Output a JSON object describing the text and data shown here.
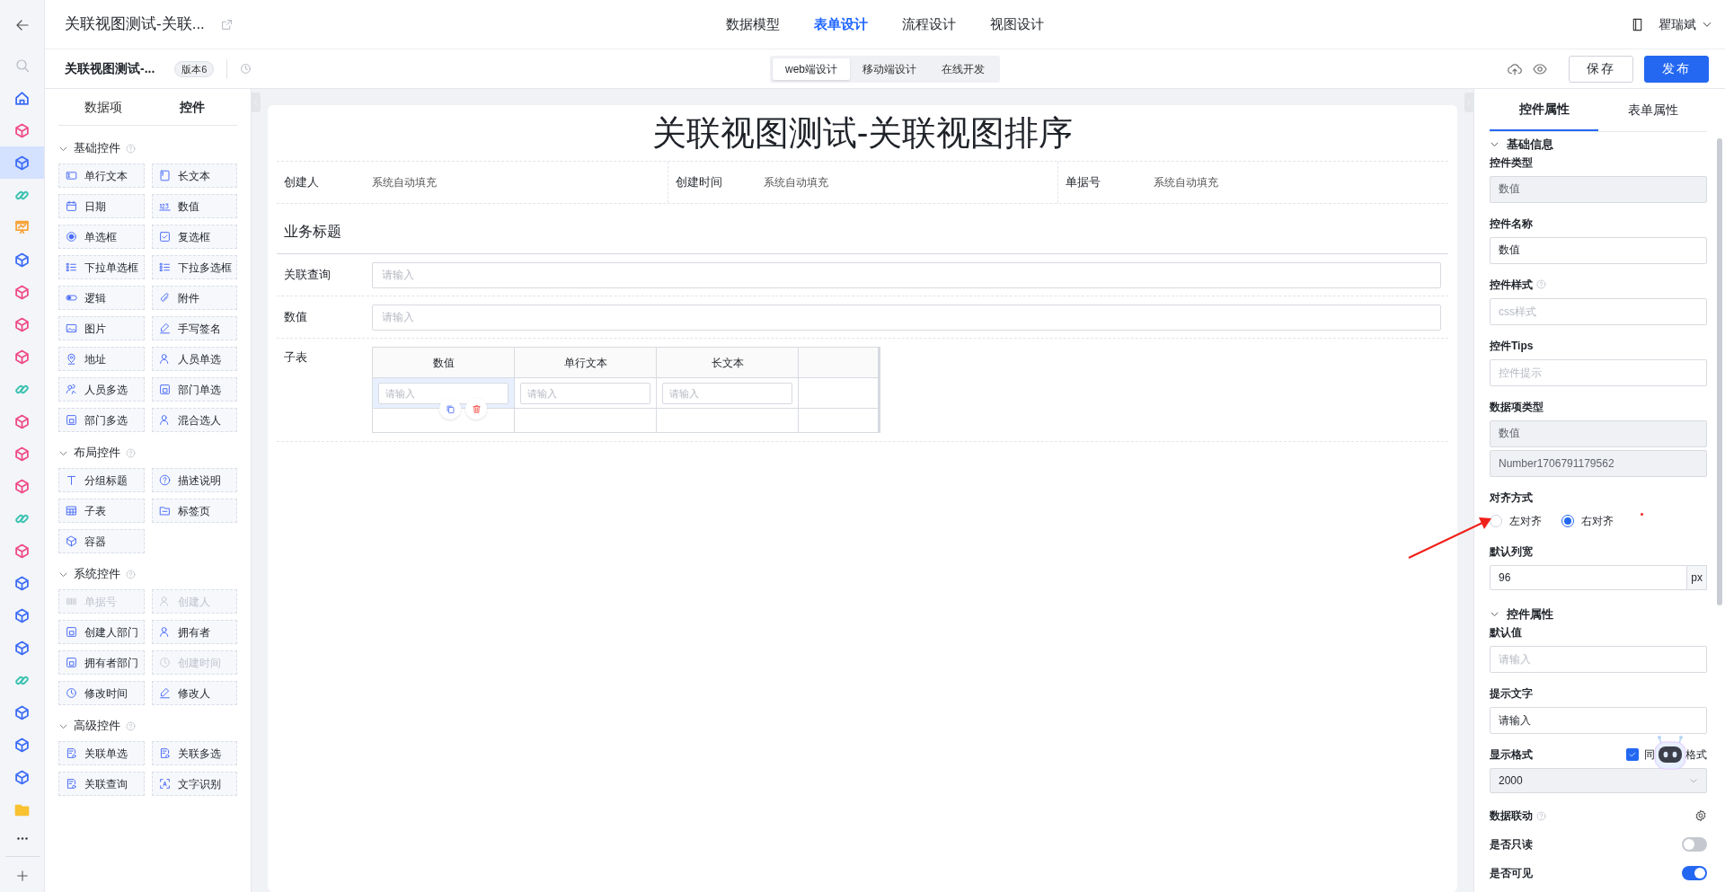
{
  "rail": {
    "items": [
      {
        "kind": "home",
        "color": "#3b6cf6",
        "selected": false
      },
      {
        "kind": "cube",
        "color": "#ef4a85",
        "selected": false
      },
      {
        "kind": "cube",
        "color": "#3b6cf6",
        "selected": true
      },
      {
        "kind": "link",
        "color": "#3cc2b2",
        "selected": false
      },
      {
        "kind": "chart",
        "color": "#f7a43a",
        "selected": false
      },
      {
        "kind": "cube",
        "color": "#3b6cf6",
        "selected": false
      },
      {
        "kind": "cube",
        "color": "#ef4a85",
        "selected": false
      },
      {
        "kind": "cube",
        "color": "#ef4a85",
        "selected": false
      },
      {
        "kind": "cube",
        "color": "#ef4a85",
        "selected": false
      },
      {
        "kind": "link",
        "color": "#3cc2b2",
        "selected": false
      },
      {
        "kind": "cube",
        "color": "#ef4a85",
        "selected": false
      },
      {
        "kind": "cube",
        "color": "#ef4a85",
        "selected": false
      },
      {
        "kind": "cube",
        "color": "#ef4a85",
        "selected": false
      },
      {
        "kind": "link",
        "color": "#3cc2b2",
        "selected": false
      },
      {
        "kind": "cube",
        "color": "#ef4a85",
        "selected": false
      },
      {
        "kind": "cube",
        "color": "#3b6cf6",
        "selected": false
      },
      {
        "kind": "cube",
        "color": "#3b6cf6",
        "selected": false
      },
      {
        "kind": "cube",
        "color": "#3b6cf6",
        "selected": false
      },
      {
        "kind": "link",
        "color": "#3cc2b2",
        "selected": false
      },
      {
        "kind": "cube",
        "color": "#3b6cf6",
        "selected": false
      },
      {
        "kind": "cube",
        "color": "#3b6cf6",
        "selected": false
      },
      {
        "kind": "cube",
        "color": "#3b6cf6",
        "selected": false
      },
      {
        "kind": "folder",
        "color": "#f8c231",
        "selected": false
      }
    ]
  },
  "top_bar": {
    "title": "关联视图测试-关联...",
    "tabs": [
      {
        "label": "数据模型",
        "selected": false
      },
      {
        "label": "表单设计",
        "selected": true
      },
      {
        "label": "流程设计",
        "selected": false
      },
      {
        "label": "视图设计",
        "selected": false
      }
    ],
    "user_name": "瞿瑞斌"
  },
  "toolbar": {
    "title": "关联视图测试-...",
    "version_badge": "版本6",
    "modes": [
      {
        "label": "web端设计",
        "selected": true
      },
      {
        "label": "移动端设计",
        "selected": false
      },
      {
        "label": "在线开发",
        "selected": false
      }
    ],
    "buttons": [
      {
        "label": "保存",
        "kind": "outline"
      },
      {
        "label": "发布",
        "kind": "primary"
      }
    ]
  },
  "palette": {
    "tabs": [
      {
        "label": "数据项",
        "selected": false
      },
      {
        "label": "控件",
        "selected": true
      }
    ],
    "sections": [
      {
        "title": "基础控件",
        "expanded": true,
        "items": [
          {
            "label": "单行文本",
            "disabled": false
          },
          {
            "label": "长文本",
            "disabled": false
          },
          {
            "label": "日期",
            "disabled": false
          },
          {
            "label": "数值",
            "disabled": false
          },
          {
            "label": "单选框",
            "disabled": false
          },
          {
            "label": "复选框",
            "disabled": false
          },
          {
            "label": "下拉单选框",
            "disabled": false
          },
          {
            "label": "下拉多选框",
            "disabled": false
          },
          {
            "label": "逻辑",
            "disabled": false
          },
          {
            "label": "附件",
            "disabled": false
          },
          {
            "label": "图片",
            "disabled": false
          },
          {
            "label": "手写签名",
            "disabled": false
          },
          {
            "label": "地址",
            "disabled": false
          },
          {
            "label": "人员单选",
            "disabled": false
          },
          {
            "label": "人员多选",
            "disabled": false
          },
          {
            "label": "部门单选",
            "disabled": false
          },
          {
            "label": "部门多选",
            "disabled": false
          },
          {
            "label": "混合选人",
            "disabled": false
          }
        ]
      },
      {
        "title": "布局控件",
        "expanded": true,
        "items": [
          {
            "label": "分组标题",
            "disabled": false
          },
          {
            "label": "描述说明",
            "disabled": false
          },
          {
            "label": "子表",
            "disabled": false
          },
          {
            "label": "标签页",
            "disabled": false
          },
          {
            "label": "容器",
            "disabled": false
          }
        ]
      },
      {
        "title": "系统控件",
        "expanded": true,
        "items": [
          {
            "label": "单据号",
            "disabled": true
          },
          {
            "label": "创建人",
            "disabled": true
          },
          {
            "label": "创建人部门",
            "disabled": false
          },
          {
            "label": "拥有者",
            "disabled": false
          },
          {
            "label": "拥有者部门",
            "disabled": false
          },
          {
            "label": "创建时间",
            "disabled": true
          },
          {
            "label": "修改时间",
            "disabled": false
          },
          {
            "label": "修改人",
            "disabled": false
          }
        ]
      },
      {
        "title": "高级控件",
        "expanded": true,
        "items": [
          {
            "label": "关联单选",
            "disabled": false
          },
          {
            "label": "关联多选",
            "disabled": false
          },
          {
            "label": "关联查询",
            "disabled": false
          },
          {
            "label": "文字识别",
            "disabled": false
          }
        ]
      }
    ]
  },
  "form": {
    "title": "关联视图测试-关联视图排序",
    "system_fields": [
      {
        "label": "创建人",
        "value": "系统自动填充"
      },
      {
        "label": "创建时间",
        "value": "系统自动填充"
      },
      {
        "label": "单据号",
        "value": "系统自动填充"
      }
    ],
    "section_title": "业务标题",
    "fields": [
      {
        "label": "关联查询",
        "placeholder": "请输入"
      },
      {
        "label": "数值",
        "placeholder": "请输入"
      }
    ],
    "subtable": {
      "label": "子表",
      "columns": [
        "数值",
        "单行文本",
        "长文本"
      ],
      "rows": [
        {
          "cells": [
            {
              "placeholder": "请输入",
              "selected": true
            },
            {
              "placeholder": "请输入",
              "selected": false
            },
            {
              "placeholder": "请输入",
              "selected": false
            }
          ]
        }
      ]
    }
  },
  "properties": {
    "tabs": [
      {
        "label": "控件属性",
        "selected": true
      },
      {
        "label": "表单属性",
        "selected": false
      }
    ],
    "sections": [
      {
        "title": "基础信息",
        "expanded": true,
        "fields": [
          {
            "kind": "input",
            "label": "控件类型",
            "value": "数值",
            "disabled": true
          },
          {
            "kind": "input",
            "label": "控件名称",
            "value": "数值",
            "disabled": false
          },
          {
            "kind": "input",
            "label": "控件样式",
            "help": true,
            "placeholder": "css样式",
            "disabled": false
          },
          {
            "kind": "input",
            "label": "控件Tips",
            "placeholder": "控件提示",
            "disabled": false
          },
          {
            "kind": "input_pair",
            "label": "数据项类型",
            "values": [
              "数值",
              "Number1706791179562"
            ],
            "disabled": true
          },
          {
            "kind": "radio",
            "label": "对齐方式",
            "options": [
              {
                "label": "左对齐",
                "selected": false
              },
              {
                "label": "右对齐",
                "selected": true
              }
            ]
          },
          {
            "kind": "addon",
            "label": "默认列宽",
            "value": "96",
            "addon": "px"
          }
        ]
      },
      {
        "title": "控件属性",
        "expanded": true,
        "fields": [
          {
            "kind": "input",
            "label": "默认值",
            "placeholder": "请输入",
            "disabled": false
          },
          {
            "kind": "input",
            "label": "提示文字",
            "value": "请输入",
            "disabled": false
          },
          {
            "kind": "select",
            "label": "显示格式",
            "value": "2000",
            "disabled": true,
            "checkbox": {
              "checked": true,
              "label_parts": [
                "同",
                "格式"
              ]
            }
          },
          {
            "kind": "gear",
            "label": "数据联动",
            "help": true
          },
          {
            "kind": "toggle",
            "label": "是否只读",
            "on": false
          },
          {
            "kind": "toggle",
            "label": "是否可见",
            "on": true
          }
        ]
      }
    ]
  }
}
